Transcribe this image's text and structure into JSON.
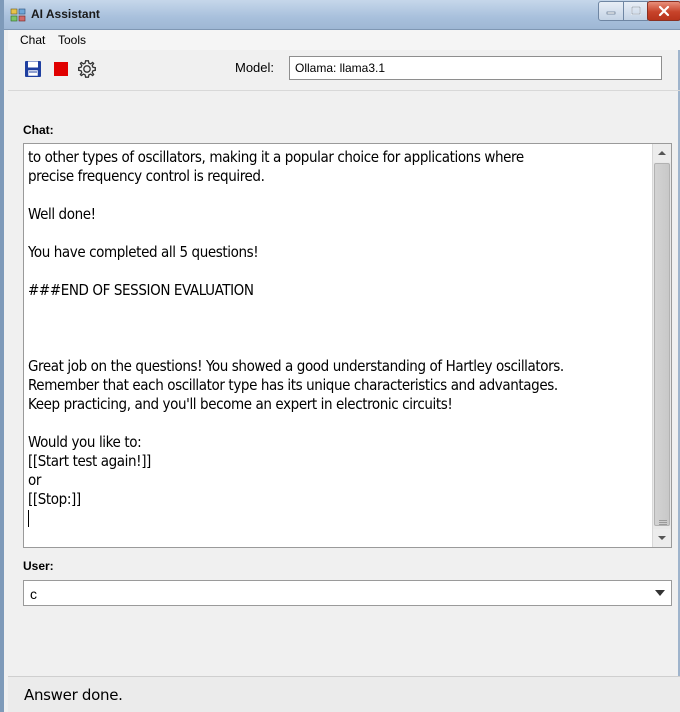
{
  "window": {
    "title": "AI Assistant",
    "buttons": [
      "minimize",
      "maximize",
      "close"
    ]
  },
  "menu": {
    "items": [
      "Chat",
      "Tools"
    ]
  },
  "toolbar": {
    "icons": [
      "save-icon",
      "stop-icon",
      "gear-icon"
    ],
    "model_label": "Model:",
    "model_value": "Ollama: llama3.1"
  },
  "chat": {
    "label": "Chat:",
    "lines": [
      "to other types of oscillators, making it a popular choice for applications where",
      "precise frequency control is required.",
      "",
      "Well done!",
      "",
      "You have completed all 5 questions!",
      "",
      "###END OF SESSION EVALUATION",
      "",
      "",
      "",
      "Great job on the questions! You showed a good understanding of Hartley oscillators.",
      "Remember that each oscillator type has its unique characteristics and advantages.",
      "Keep practicing, and you'll become an expert in electronic circuits!",
      "",
      "Would you like to:",
      "[[Start test again!]]",
      "or",
      "[[Stop:]]"
    ]
  },
  "user": {
    "label": "User:",
    "value": "c"
  },
  "status": {
    "text": "Answer done."
  },
  "colors": {
    "title_gradient_top": "#c6d7ea",
    "title_gradient_bottom": "#9eb7d4",
    "close_button": "#c7432a",
    "stop_red": "#e00000",
    "save_blue": "#1f3fa0"
  }
}
